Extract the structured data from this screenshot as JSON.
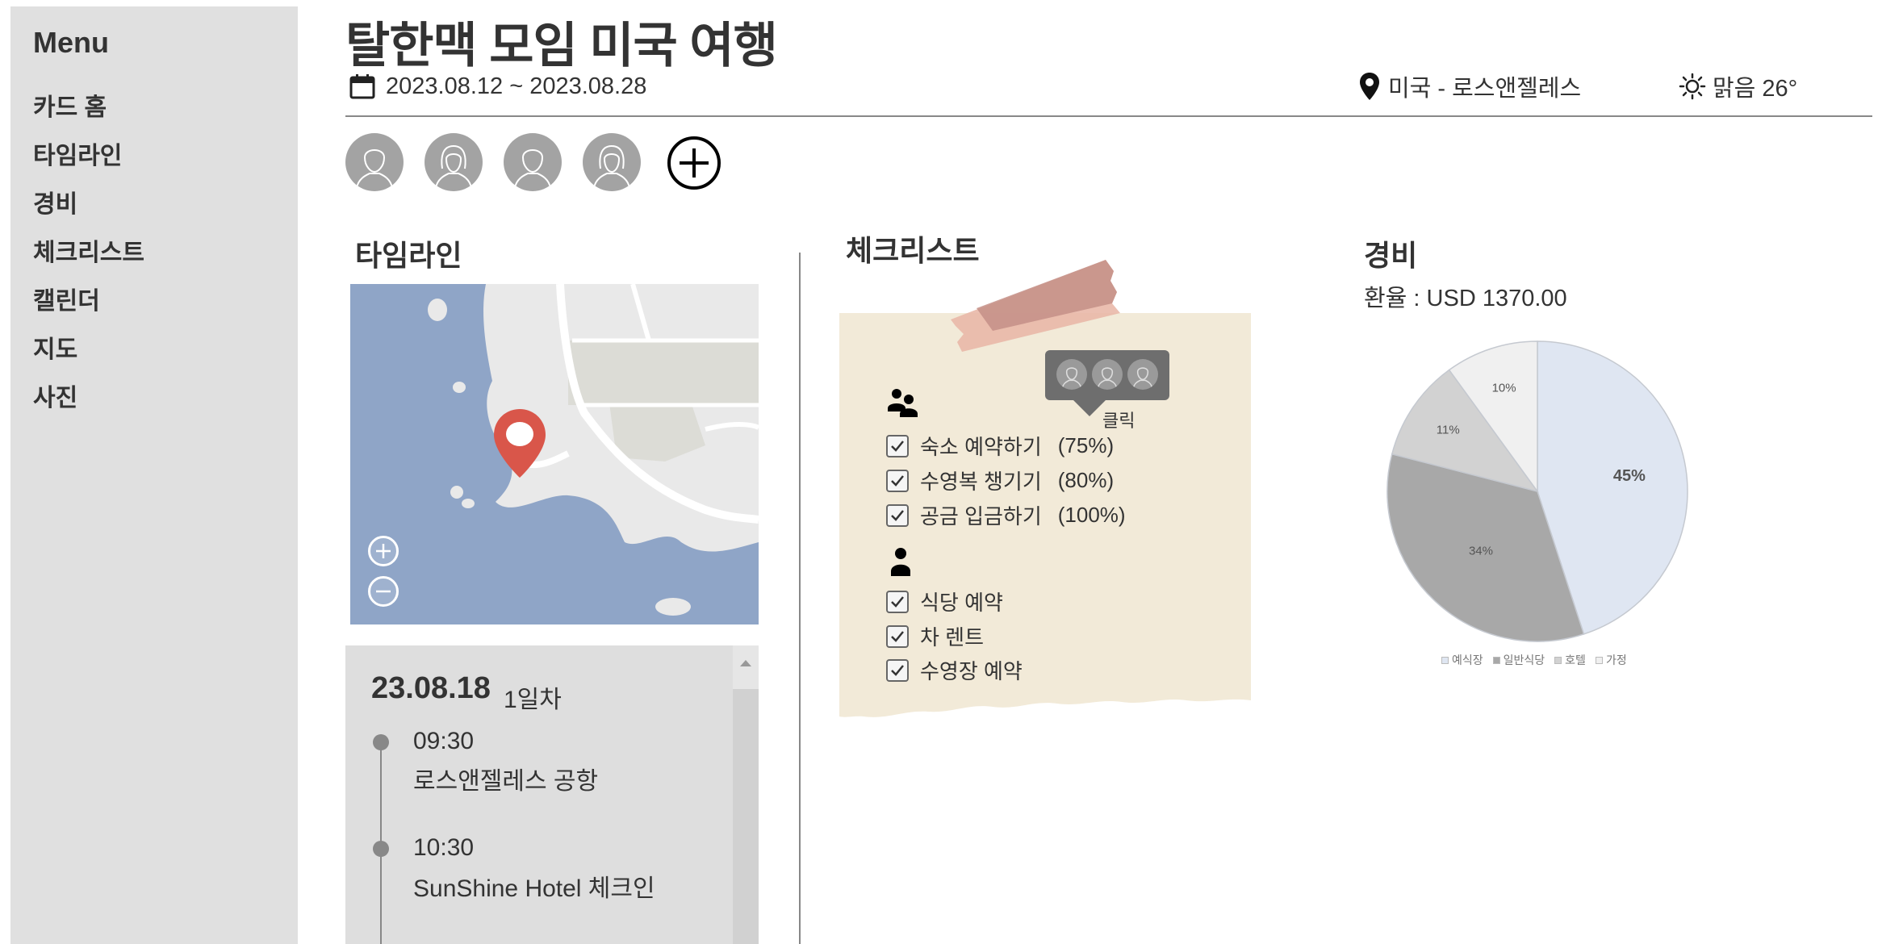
{
  "sidebar": {
    "title": "Menu",
    "items": [
      {
        "label": "카드 홈"
      },
      {
        "label": "타임라인"
      },
      {
        "label": "경비"
      },
      {
        "label": "체크리스트"
      },
      {
        "label": "캘린더"
      },
      {
        "label": "지도"
      },
      {
        "label": "사진"
      }
    ]
  },
  "header": {
    "title": "탈한맥 모임 미국 여행",
    "dates": "2023.08.12 ~ 2023.08.28",
    "location": "미국 - 로스앤젤레스",
    "weather": "맑음 26°",
    "icons": {
      "calendar": "calendar-icon",
      "location": "location-pin-icon",
      "weather": "sun-icon"
    }
  },
  "members": {
    "avatars": [
      "male-avatar",
      "female-avatar",
      "male-avatar",
      "female-avatar"
    ],
    "add_icon": "plus-circle-icon"
  },
  "timeline": {
    "title": "타임라인",
    "date": "23.08.18",
    "day": "1일차",
    "events": [
      {
        "time": "09:30",
        "place": "로스앤젤레스 공항"
      },
      {
        "time": "10:30",
        "place": "SunShine Hotel 체크인"
      }
    ]
  },
  "checklist": {
    "title": "체크리스트",
    "tooltip_label": "클릭",
    "group_icon": "group-icon",
    "personal_icon": "person-icon",
    "group_items": [
      {
        "label": "숙소 예약하기",
        "progress": "(75%)",
        "checked": true
      },
      {
        "label": "수영복 챙기기",
        "progress": "(80%)",
        "checked": true
      },
      {
        "label": "공금 입금하기",
        "progress": "(100%)",
        "checked": true
      }
    ],
    "personal_items": [
      {
        "label": "식당 예약",
        "checked": true
      },
      {
        "label": "차 렌트",
        "checked": true
      },
      {
        "label": "수영장 예약",
        "checked": true
      }
    ]
  },
  "expense": {
    "title": "경비",
    "exchange_rate": "환율 : USD 1370.00"
  },
  "chart_data": {
    "type": "pie",
    "labels": [
      "예식장",
      "일반식당",
      "호텔",
      "가정"
    ],
    "values": [
      45,
      34,
      11,
      10
    ],
    "value_labels": [
      "45%",
      "34%",
      "11%",
      "10%"
    ],
    "colors": [
      "#dfe6f2",
      "#a8a8a8",
      "#d2d2d2",
      "#f0f0f0"
    ],
    "legend": "bottom"
  }
}
